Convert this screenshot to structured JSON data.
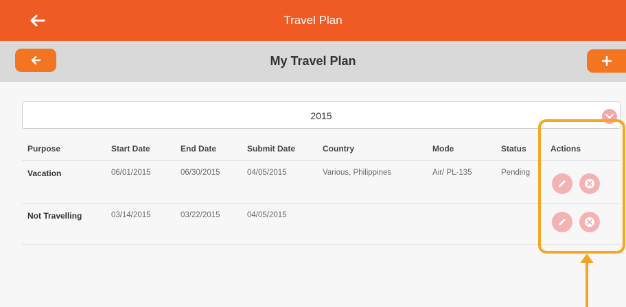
{
  "app_bar": {
    "title": "Travel Plan",
    "back_icon": "arrow-left-icon",
    "color": "#f05a24"
  },
  "sub_bar": {
    "title": "My Travel Plan",
    "back_icon": "arrow-left-icon",
    "add_icon": "plus-icon",
    "color": "#d9d9d9"
  },
  "year_filter": {
    "value": "2015"
  },
  "table": {
    "headers": [
      "Purpose",
      "Start Date",
      "End Date",
      "Submit Date",
      "Country",
      "Mode",
      "Status",
      "Actions"
    ],
    "rows": [
      {
        "purpose": "Vacation",
        "start": "06/01/2015",
        "end": "06/30/2015",
        "submit": "04/05/2015",
        "country": "Various, Philippines",
        "mode": "Air/ PL-135",
        "status": "Pending"
      },
      {
        "purpose": "Not Travelling",
        "start": "03/14/2015",
        "end": "03/22/2015",
        "submit": "04/05/2015",
        "country": "",
        "mode": "",
        "status": ""
      }
    ],
    "row_actions": [
      "edit-icon",
      "delete-icon"
    ]
  },
  "annotation": {
    "color": "#f5a623"
  }
}
